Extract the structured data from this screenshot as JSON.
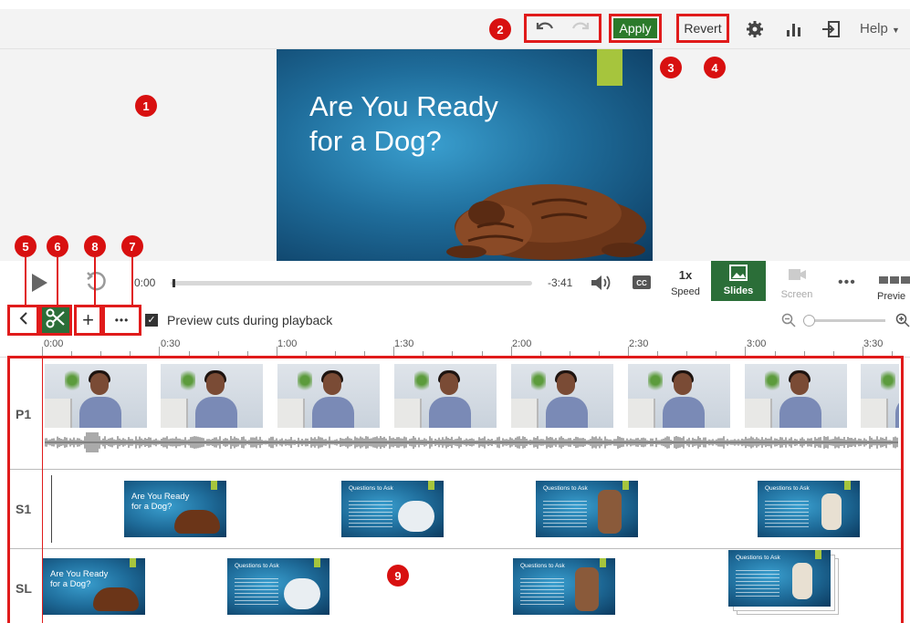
{
  "toolbar": {
    "apply_label": "Apply",
    "revert_label": "Revert",
    "help_label": "Help"
  },
  "callouts": [
    "1",
    "2",
    "3",
    "4",
    "5",
    "6",
    "7",
    "8",
    "9"
  ],
  "slide": {
    "title_line1": "Are You Ready",
    "title_line2": "for a Dog?"
  },
  "player": {
    "current_time": "0:00",
    "remaining_time": "-3:41",
    "progress": 0.005,
    "speed_value": "1x",
    "speed_label": "Speed",
    "slides_label": "Slides",
    "screen_label": "Screen",
    "preview_label": "Previe"
  },
  "edit": {
    "preview_cuts_label": "Preview cuts during playback",
    "preview_cuts_checked": true
  },
  "ruler": [
    "0:00",
    "0:30",
    "1:00",
    "1:30",
    "2:00",
    "2:30",
    "3:00",
    "3:30"
  ],
  "tracks": {
    "p1": "P1",
    "s1": "S1",
    "sl": "SL"
  },
  "mini_slides": {
    "title_line1": "Are You Ready",
    "title_line2": "for a Dog?",
    "question": "Questions to Ask"
  },
  "colors": {
    "accent_green": "#2b7a2b",
    "callout_red": "#d81010",
    "slide_tab": "#a6c53d"
  }
}
